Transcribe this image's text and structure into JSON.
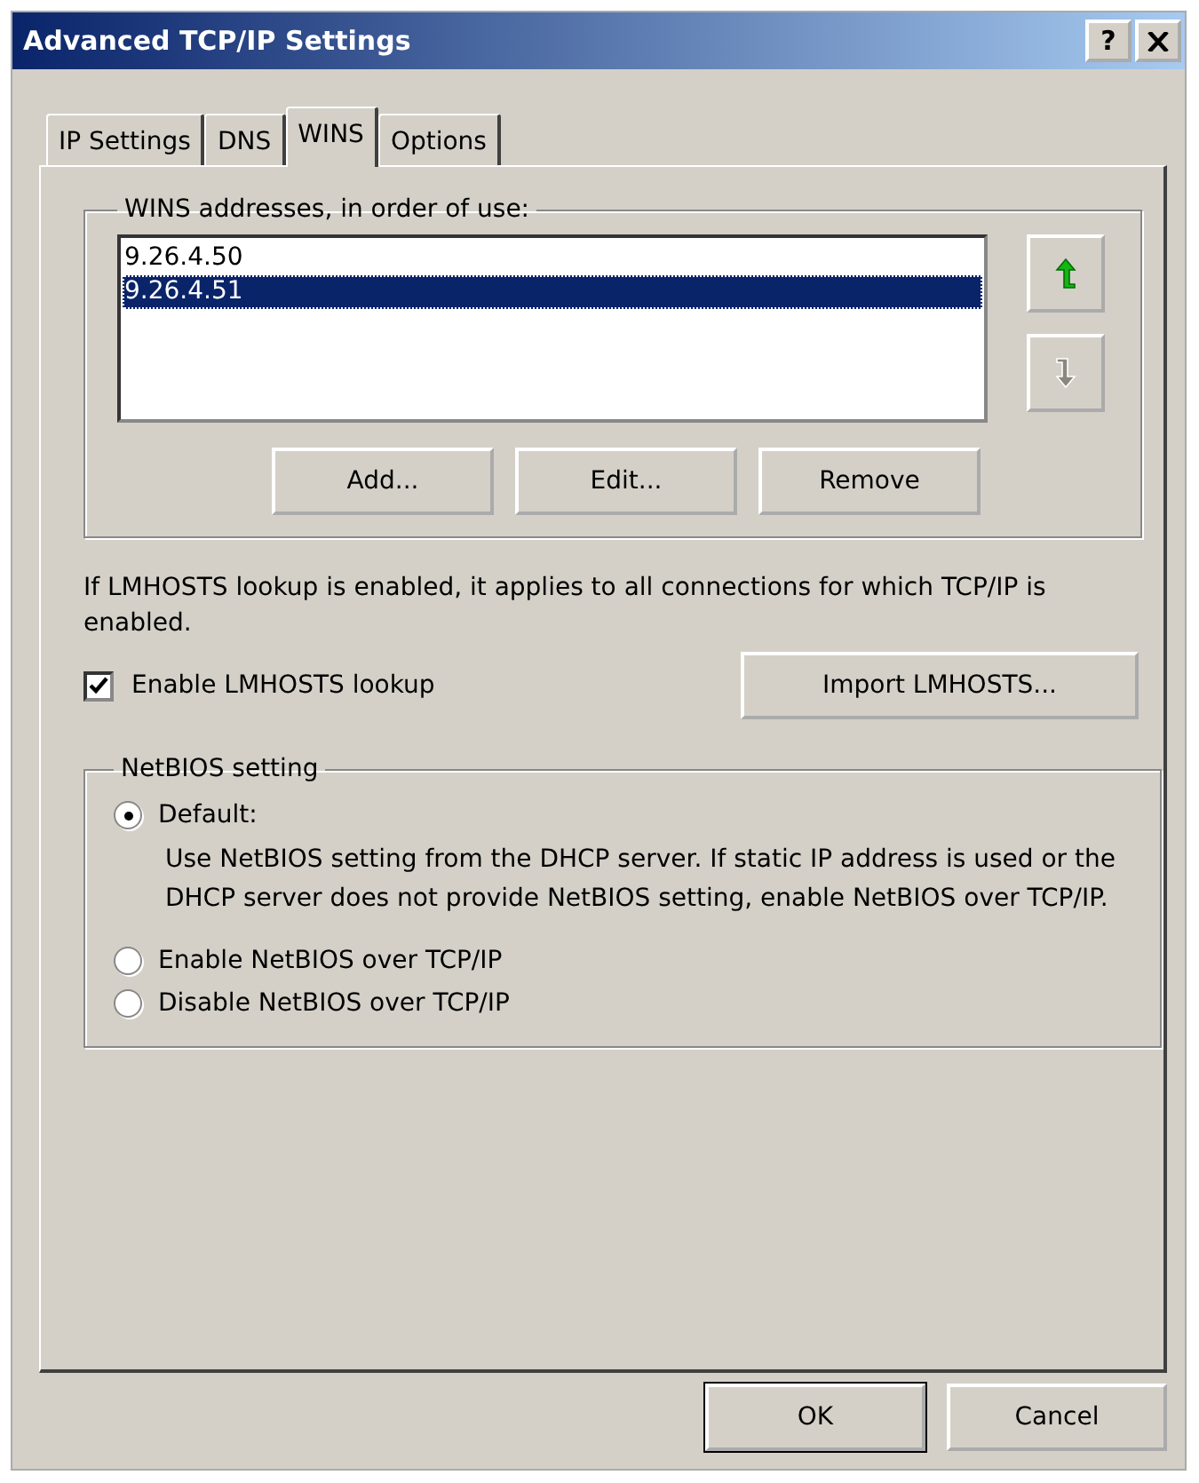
{
  "window": {
    "title": "Advanced TCP/IP Settings",
    "help_button": "?"
  },
  "tabs": [
    {
      "label": "IP Settings",
      "selected": false
    },
    {
      "label": "DNS",
      "selected": false
    },
    {
      "label": "WINS",
      "selected": true
    },
    {
      "label": "Options",
      "selected": false
    }
  ],
  "wins_group": {
    "label": "WINS addresses, in order of use:",
    "addresses": [
      {
        "text": "9.26.4.50",
        "selected": false
      },
      {
        "text": "9.26.4.51",
        "selected": true
      }
    ],
    "move_buttons": [
      {
        "kind": "up",
        "disabled": false
      },
      {
        "kind": "down",
        "disabled": true
      }
    ],
    "buttons": [
      "Add...",
      "Edit...",
      "Remove"
    ]
  },
  "lmhosts_note": "If LMHOSTS lookup is enabled, it applies to all connections for which TCP/IP is enabled.",
  "lmhosts_checkbox": {
    "label": "Enable LMHOSTS lookup",
    "checked": true
  },
  "import_button": "Import LMHOSTS...",
  "netbios_group": {
    "label": "NetBIOS setting",
    "options": [
      {
        "label": "Default:",
        "selected": true,
        "description": "Use NetBIOS setting from the DHCP server. If static IP address is used or the DHCP server does not provide NetBIOS setting, enable NetBIOS over TCP/IP."
      },
      {
        "label": "Enable NetBIOS over TCP/IP",
        "selected": false
      },
      {
        "label": "Disable NetBIOS over TCP/IP",
        "selected": false
      }
    ]
  },
  "footer_buttons": [
    {
      "label": "OK",
      "default": true
    },
    {
      "label": "Cancel",
      "default": false
    }
  ]
}
